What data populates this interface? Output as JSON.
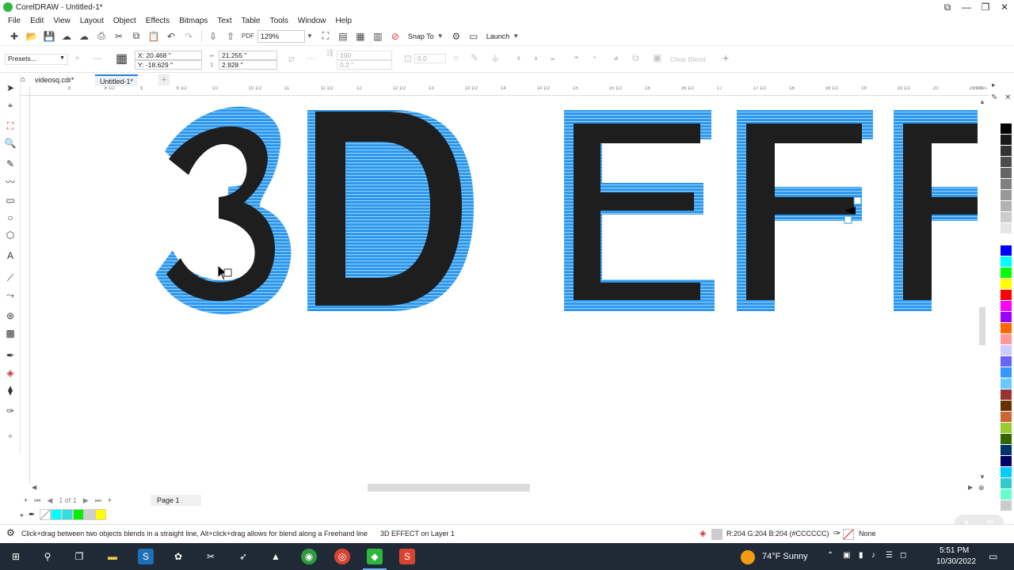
{
  "window": {
    "title": "CorelDRAW - Untitled-1*"
  },
  "menu": [
    "File",
    "Edit",
    "View",
    "Layout",
    "Object",
    "Effects",
    "Bitmaps",
    "Text",
    "Table",
    "Tools",
    "Window",
    "Help"
  ],
  "standard_toolbar": {
    "zoom": "129%",
    "snap_to": "Snap To",
    "launch": "Launch"
  },
  "property_bar": {
    "presets": "Presets...",
    "x": "X: 20.468 \"",
    "y": "Y: -18.629 \"",
    "width": "21.255 \"",
    "height": "2.928 \"",
    "steps": "100",
    "offset": "0.2 \"",
    "angle": "0.0",
    "clear_blend": "Clear Blend"
  },
  "tabs": [
    {
      "label": "videosq.cdr*",
      "active": false
    },
    {
      "label": "Untitled-1*",
      "active": true
    }
  ],
  "ruler": {
    "labels": [
      "8",
      "8 1/2",
      "9",
      "9 1/2",
      "10",
      "10 1/2",
      "11",
      "11 1/2",
      "12",
      "12 1/2",
      "13",
      "13 1/2",
      "14",
      "14 1/2",
      "15",
      "15 1/2",
      "16",
      "16 1/2",
      "17",
      "17 1/2",
      "18",
      "18 1/2",
      "19",
      "19 1/2",
      "20",
      "20 1/2",
      "21"
    ],
    "unit": "inches"
  },
  "canvas_text": {
    "letters": [
      "3",
      "D",
      "E",
      "F",
      "F"
    ],
    "label": "3D EFFECT"
  },
  "page_nav": {
    "counter": "1 of 1",
    "page_tab": "Page 1"
  },
  "status": {
    "hint": "Click+drag between two objects blends in a straight line, Alt+click+drag allows for blend along a Freehand line",
    "object": "3D EFFECT on Layer 1",
    "fill": "R:204 G:204 B:204 (#CCCCCC)",
    "outline": "None"
  },
  "taskbar": {
    "weather": "74°F Sunny",
    "time": "5:51 PM",
    "date": "10/30/2022"
  },
  "colors": {
    "accent": "#1e8fe8",
    "fill_dark": "#1e1e1e",
    "extrude_light": "#5ab4f2"
  },
  "palette": [
    "#ffffff",
    "#000000",
    "#1a1a1a",
    "#333333",
    "#4d4d4d",
    "#666666",
    "#808080",
    "#999999",
    "#b3b3b3",
    "#cccccc",
    "#e6e6e6",
    "#ffffff",
    "#0000ff",
    "#00ffff",
    "#00ff00",
    "#ffff00",
    "#ff0000",
    "#ff00ff",
    "#9900ff",
    "#ff6600",
    "#ff9999",
    "#ccccff",
    "#6666ff",
    "#3399ff",
    "#66ccff",
    "#993333",
    "#663300",
    "#cc6633",
    "#99cc33",
    "#336600",
    "#003366",
    "#000066",
    "#00ccff",
    "#33cccc",
    "#66ffcc",
    "#cccccc"
  ],
  "document_palette": [
    "#ffffff",
    "#00ffff",
    "#33e0e0",
    "#00ff00",
    "#ffffff",
    "#ffff00"
  ]
}
